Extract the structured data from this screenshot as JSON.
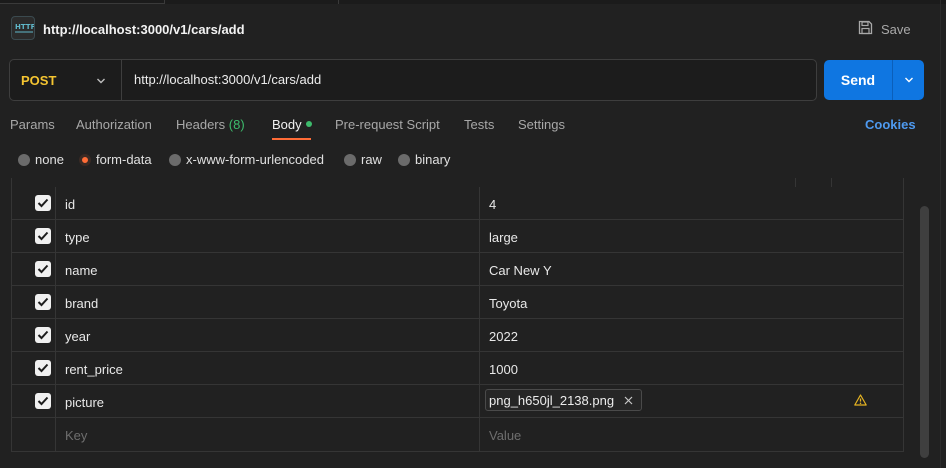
{
  "request": {
    "title": "http://localhost:3000/v1/cars/add",
    "save_label": "Save",
    "method": "POST",
    "url": "http://localhost:3000/v1/cars/add",
    "send_label": "Send"
  },
  "tabs": [
    {
      "label": "Params"
    },
    {
      "label": "Authorization"
    },
    {
      "label": "Headers",
      "count": "(8)"
    },
    {
      "label": "Body"
    },
    {
      "label": "Pre-request Script"
    },
    {
      "label": "Tests"
    },
    {
      "label": "Settings"
    }
  ],
  "cookies_label": "Cookies",
  "body_types": [
    {
      "label": "none",
      "selected": false
    },
    {
      "label": "form-data",
      "selected": true
    },
    {
      "label": "x-www-form-urlencoded",
      "selected": false
    },
    {
      "label": "raw",
      "selected": false
    },
    {
      "label": "binary",
      "selected": false
    }
  ],
  "form_rows": [
    {
      "key": "id",
      "value": "4",
      "checked": true
    },
    {
      "key": "type",
      "value": "large",
      "checked": true
    },
    {
      "key": "name",
      "value": "Car New Y",
      "checked": true
    },
    {
      "key": "brand",
      "value": "Toyota",
      "checked": true
    },
    {
      "key": "year",
      "value": "2022",
      "checked": true
    },
    {
      "key": "rent_price",
      "value": "1000",
      "checked": true
    },
    {
      "key": "picture",
      "file": "png_h650jl_2138.png",
      "checked": true,
      "warning": true
    }
  ],
  "placeholders": {
    "key": "Key",
    "value": "Value"
  },
  "colors": {
    "accent": "#ff6c37",
    "send": "#0f76e1",
    "method": "#f5c531",
    "cookies": "#4e9af0",
    "active_dot": "#3dbb6c"
  }
}
